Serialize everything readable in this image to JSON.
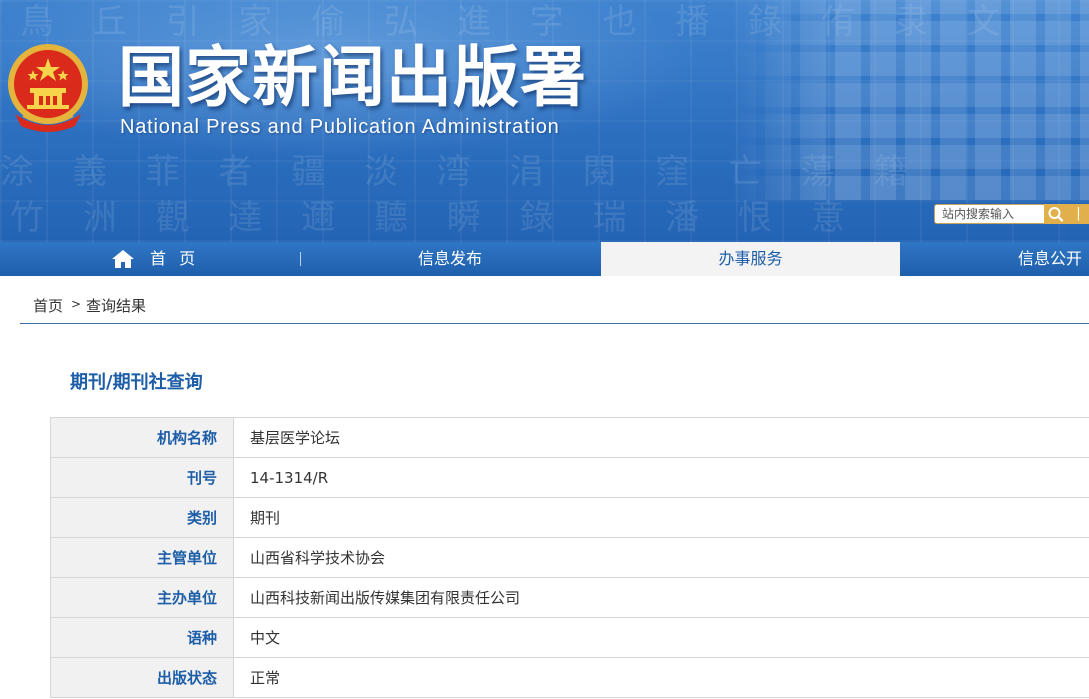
{
  "header": {
    "title": "国家新闻出版署",
    "subtitle": "National Press and Publication Administration",
    "search": {
      "placeholder": "站内搜索输入",
      "separator": "|"
    }
  },
  "nav": {
    "items": [
      {
        "label": "首 页",
        "icon": "home-icon"
      },
      {
        "label": "信息发布"
      },
      {
        "label": "办事服务",
        "active": true
      },
      {
        "label": "信息公开"
      }
    ]
  },
  "breadcrumb": {
    "home": "首页",
    "separator": ">",
    "current": "查询结果"
  },
  "section": {
    "title": "期刊/期刊社查询"
  },
  "details": {
    "rows": [
      {
        "label": "机构名称",
        "value": "基层医学论坛"
      },
      {
        "label": "刊号",
        "value": "14-1314/R"
      },
      {
        "label": "类别",
        "value": "期刊"
      },
      {
        "label": "主管单位",
        "value": "山西省科学技术协会"
      },
      {
        "label": "主办单位",
        "value": "山西科技新闻出版传媒集团有限责任公司"
      },
      {
        "label": "语种",
        "value": "中文"
      },
      {
        "label": "出版状态",
        "value": "正常"
      }
    ]
  },
  "colors": {
    "brand_blue": "#1e5ea8",
    "header_blue": "#2c6fbf",
    "search_gold": "#e2b04a"
  }
}
